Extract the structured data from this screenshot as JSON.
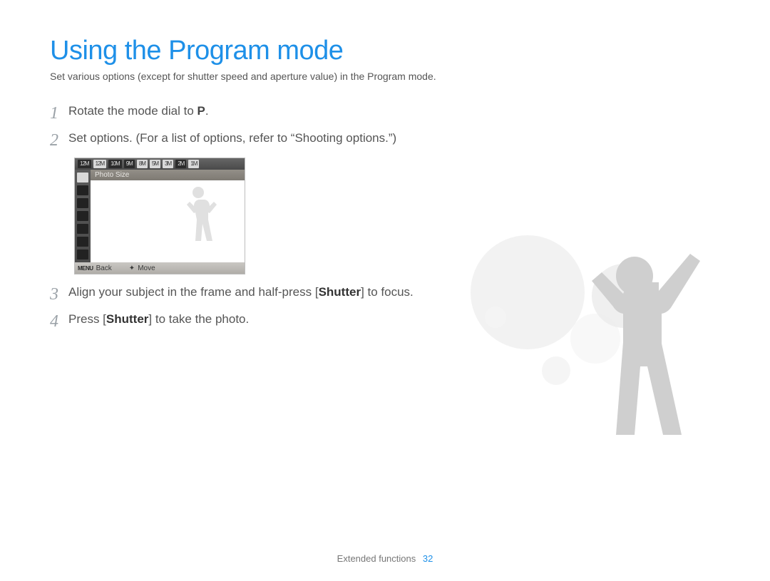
{
  "title": "Using the Program mode",
  "subtitle": "Set various options (except for shutter speed and aperture value) in the Program mode.",
  "steps": {
    "s1_pre": "Rotate the mode dial to ",
    "s1_mode": "P",
    "s1_post": ".",
    "s2": "Set options. (For a list of options, refer to “Shooting options.”)",
    "s3_pre": "Align your subject in the frame and half-press [",
    "s3_bold": "Shutter",
    "s3_post": "] to focus.",
    "s4_pre": "Press [",
    "s4_bold": "Shutter",
    "s4_post": "] to take the photo."
  },
  "lcd": {
    "top_icons": [
      "12M",
      "12M",
      "10M",
      "9M",
      "8M",
      "5M",
      "3M",
      "2M",
      "1M"
    ],
    "label": "Photo Size",
    "back": "Back",
    "move": "Move",
    "menu_glyph": "MENU",
    "move_glyph": "✦"
  },
  "footer": {
    "section": "Extended functions",
    "page": "32"
  }
}
